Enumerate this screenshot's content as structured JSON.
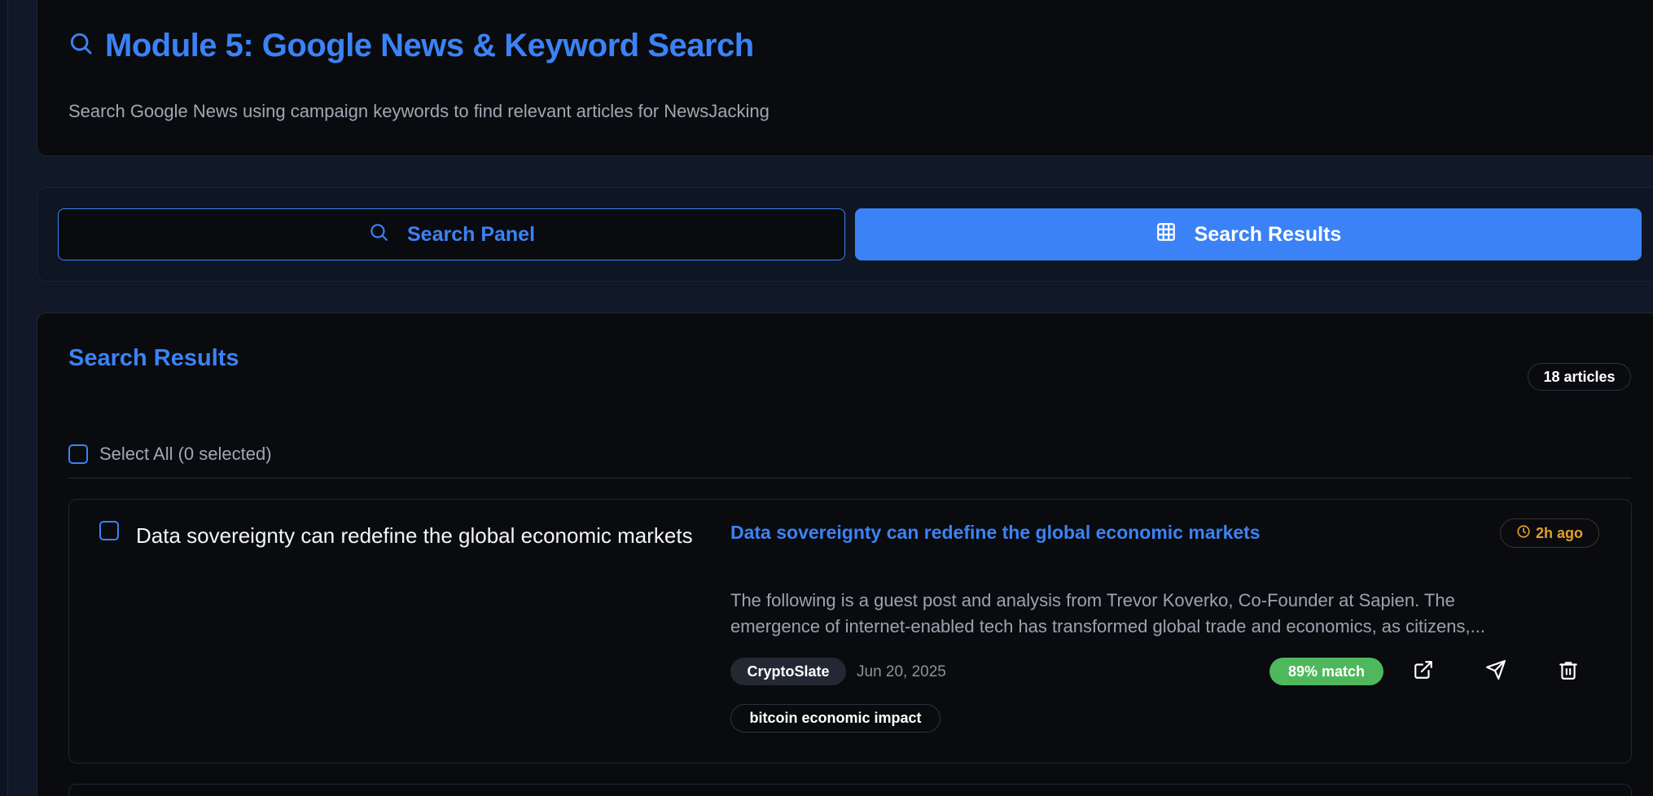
{
  "header": {
    "title": "Module 5: Google News & Keyword Search",
    "subtitle": "Search Google News using campaign keywords to find relevant articles for NewsJacking",
    "icon": "search-icon"
  },
  "tabs": [
    {
      "label": "Search Panel",
      "icon": "search-icon",
      "active": false
    },
    {
      "label": "Search Results",
      "icon": "grid-icon",
      "active": true
    }
  ],
  "results": {
    "title": "Search Results",
    "count_label": "18 articles",
    "select_all_label": "Select All (0 selected)",
    "articles": [
      {
        "checkbox_label": "Data sovereignty can redefine the global economic markets",
        "title": "Data sovereignty can redefine the global economic markets",
        "time_ago": "2h ago",
        "snippet_line1": "The following is a guest post and analysis from Trevor Koverko, Co-Founder at Sapien. The",
        "snippet_line2": "emergence of internet-enabled tech has transformed global trade and economics, as citizens,...",
        "source": "CryptoSlate",
        "date": "Jun 20, 2025",
        "match": "89% match",
        "keyword": "bitcoin economic impact"
      }
    ]
  },
  "colors": {
    "accent": "#3b82f6",
    "background": "#111827",
    "card": "#0a0b0e",
    "match_green": "#4fb85c",
    "time_amber": "#e0a030"
  }
}
